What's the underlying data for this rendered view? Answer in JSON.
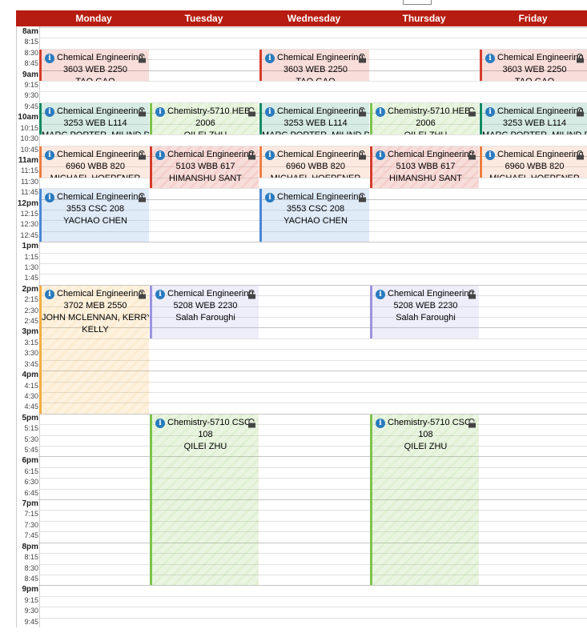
{
  "days": [
    "Monday",
    "Tuesday",
    "Wednesday",
    "Thursday",
    "Friday"
  ],
  "times": [
    "8am",
    "8:15",
    "8:30",
    "8:45",
    "9am",
    "9:15",
    "9:30",
    "9:45",
    "10am",
    "10:15",
    "10:30",
    "10:45",
    "11am",
    "11:15",
    "11:30",
    "11:45",
    "12pm",
    "12:15",
    "12:30",
    "12:45",
    "1pm",
    "1:15",
    "1:30",
    "1:45",
    "2pm",
    "2:15",
    "2:30",
    "2:45",
    "3pm",
    "3:15",
    "3:30",
    "3:45",
    "4pm",
    "4:15",
    "4:30",
    "4:45",
    "5pm",
    "5:15",
    "5:30",
    "5:45",
    "6pm",
    "6:15",
    "6:30",
    "6:45",
    "7pm",
    "7:15",
    "7:30",
    "7:45",
    "8pm",
    "8:15",
    "8:30",
    "8:45",
    "9pm",
    "9:15",
    "9:30",
    "9:45"
  ],
  "colors": {
    "red": "#d63b2a",
    "teal": "#0f8a62",
    "orange": "#ec7d3f",
    "blue": "#4a86d6",
    "peach": "#f5ae3f",
    "purple": "#9c93e0",
    "green": "#7cc34c",
    "header": "#b71c10"
  },
  "events": [
    {
      "day": 0,
      "start": "8:30",
      "end": "9:15",
      "color": "red",
      "lines": [
        "Chemical Engineering",
        "3603 WEB 2250",
        "TAO GAO"
      ],
      "hatched": false,
      "locked": true
    },
    {
      "day": 2,
      "start": "8:30",
      "end": "9:15",
      "color": "red",
      "lines": [
        "Chemical Engineering",
        "3603 WEB 2250",
        "TAO GAO"
      ],
      "hatched": false,
      "locked": true
    },
    {
      "day": 4,
      "start": "8:30",
      "end": "9:15",
      "color": "red",
      "lines": [
        "Chemical Engineering",
        "3603 WEB 2250",
        "TAO GAO"
      ],
      "hatched": false,
      "locked": true
    },
    {
      "day": 0,
      "start": "9:45",
      "end": "10:30",
      "color": "teal",
      "lines": [
        "Chemical Engineering",
        "3253 WEB L114",
        "MARC PORTER, MILIND DEO"
      ],
      "hatched": false,
      "locked": true
    },
    {
      "day": 1,
      "start": "9:45",
      "end": "10:30",
      "color": "green",
      "lines": [
        "Chemistry-5710 HEB",
        "2006",
        "QILEI ZHU"
      ],
      "hatched": true,
      "locked": true
    },
    {
      "day": 2,
      "start": "9:45",
      "end": "10:30",
      "color": "teal",
      "lines": [
        "Chemical Engineering",
        "3253 WEB L114",
        "MARC PORTER, MILIND DEO"
      ],
      "hatched": false,
      "locked": true
    },
    {
      "day": 3,
      "start": "9:45",
      "end": "10:30",
      "color": "green",
      "lines": [
        "Chemistry-5710 HEB",
        "2006",
        "QILEI ZHU"
      ],
      "hatched": true,
      "locked": true
    },
    {
      "day": 4,
      "start": "9:45",
      "end": "10:30",
      "color": "teal",
      "lines": [
        "Chemical Engineering",
        "3253 WEB L114",
        "MARC PORTER, MILIND DEO"
      ],
      "hatched": false,
      "locked": true
    },
    {
      "day": 0,
      "start": "10:45",
      "end": "11:30",
      "color": "orange",
      "lines": [
        "Chemical Engineering",
        "6960 WBB 820",
        "MICHAEL HOEPFNER"
      ],
      "hatched": false,
      "locked": true
    },
    {
      "day": 1,
      "start": "10:45",
      "end": "11:45",
      "color": "red",
      "lines": [
        "Chemical Engineering",
        "5103 WBB 617",
        "HIMANSHU SANT"
      ],
      "hatched": true,
      "locked": true
    },
    {
      "day": 2,
      "start": "10:45",
      "end": "11:30",
      "color": "orange",
      "lines": [
        "Chemical Engineering",
        "6960 WBB 820",
        "MICHAEL HOEPFNER"
      ],
      "hatched": false,
      "locked": true
    },
    {
      "day": 3,
      "start": "10:45",
      "end": "11:45",
      "color": "red",
      "lines": [
        "Chemical Engineering",
        "5103 WBB 617",
        "HIMANSHU SANT"
      ],
      "hatched": true,
      "locked": true
    },
    {
      "day": 4,
      "start": "10:45",
      "end": "11:30",
      "color": "orange",
      "lines": [
        "Chemical Engineering",
        "6960 WBB 820",
        "MICHAEL HOEPFNER"
      ],
      "hatched": false,
      "locked": true
    },
    {
      "day": 0,
      "start": "11:45",
      "end": "1pm",
      "color": "blue",
      "lines": [
        "Chemical Engineering",
        "3553 CSC 208",
        "YACHAO CHEN"
      ],
      "hatched": false,
      "locked": true
    },
    {
      "day": 2,
      "start": "11:45",
      "end": "1pm",
      "color": "blue",
      "lines": [
        "Chemical Engineering",
        "3553 CSC 208",
        "YACHAO CHEN"
      ],
      "hatched": false,
      "locked": true
    },
    {
      "day": 0,
      "start": "2pm",
      "end": "5pm",
      "color": "peach",
      "lines": [
        "Chemical Engineering",
        "3702 MEB 2550",
        "JOHN MCLENNAN, KERRY",
        "KELLY"
      ],
      "hatched": true,
      "locked": true
    },
    {
      "day": 1,
      "start": "2pm",
      "end": "3:15",
      "color": "purple",
      "lines": [
        "Chemical Engineering",
        "5208 WEB 2230",
        "Salah Faroughi"
      ],
      "hatched": false,
      "locked": true
    },
    {
      "day": 3,
      "start": "2pm",
      "end": "3:15",
      "color": "purple",
      "lines": [
        "Chemical Engineering",
        "5208 WEB 2230",
        "Salah Faroughi"
      ],
      "hatched": false,
      "locked": true
    },
    {
      "day": 1,
      "start": "5pm",
      "end": "9pm",
      "color": "green",
      "lines": [
        "Chemistry-5710 CSC",
        "108",
        "QILEI ZHU"
      ],
      "hatched": true,
      "locked": true
    },
    {
      "day": 3,
      "start": "5pm",
      "end": "9pm",
      "color": "green",
      "lines": [
        "Chemistry-5710 CSC",
        "108",
        "QILEI ZHU"
      ],
      "hatched": true,
      "locked": true
    }
  ]
}
